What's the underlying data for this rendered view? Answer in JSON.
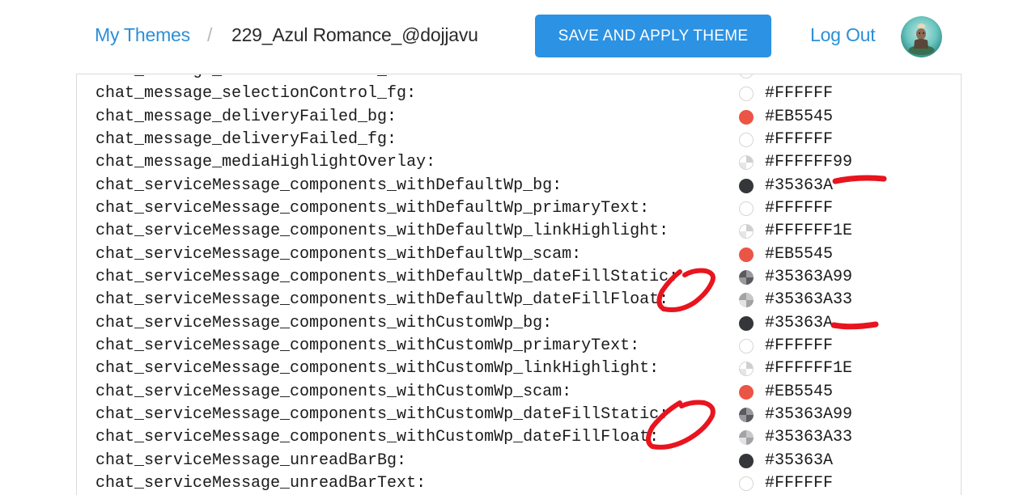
{
  "header": {
    "breadcrumb_link": "My Themes",
    "breadcrumb_separator": "/",
    "breadcrumb_current": "229_Azul Romance_@dojjavu",
    "save_button": "SAVE AND APPLY THEME",
    "logout": "Log Out",
    "accent_color": "#2B92E4"
  },
  "rows": [
    {
      "key": "chat_message_selectionControl_border:",
      "value": "#FFFFFF",
      "swatch": "white"
    },
    {
      "key": "chat_message_selectionControl_fg:",
      "value": "#FFFFFF",
      "swatch": "white"
    },
    {
      "key": "chat_message_deliveryFailed_bg:",
      "value": "#EB5545",
      "swatch": "red"
    },
    {
      "key": "chat_message_deliveryFailed_fg:",
      "value": "#FFFFFF",
      "swatch": "white"
    },
    {
      "key": "chat_message_mediaHighlightOverlay:",
      "value": "#FFFFFF99",
      "swatch": "white-translucent"
    },
    {
      "key": "chat_serviceMessage_components_withDefaultWp_bg:",
      "value": "#35363A",
      "swatch": "dark"
    },
    {
      "key": "chat_serviceMessage_components_withDefaultWp_primaryText:",
      "value": "#FFFFFF",
      "swatch": "white"
    },
    {
      "key": "chat_serviceMessage_components_withDefaultWp_linkHighlight:",
      "value": "#FFFFFF1E",
      "swatch": "white-translucent"
    },
    {
      "key": "chat_serviceMessage_components_withDefaultWp_scam:",
      "value": "#EB5545",
      "swatch": "red"
    },
    {
      "key": "chat_serviceMessage_components_withDefaultWp_dateFillStatic:",
      "value": "#35363A99",
      "swatch": "dark-translucent"
    },
    {
      "key": "chat_serviceMessage_components_withDefaultWp_dateFillFloat:",
      "value": "#35363A33",
      "swatch": "dark-light-translucent"
    },
    {
      "key": "chat_serviceMessage_components_withCustomWp_bg:",
      "value": "#35363A",
      "swatch": "dark"
    },
    {
      "key": "chat_serviceMessage_components_withCustomWp_primaryText:",
      "value": "#FFFFFF",
      "swatch": "white"
    },
    {
      "key": "chat_serviceMessage_components_withCustomWp_linkHighlight:",
      "value": "#FFFFFF1E",
      "swatch": "white-translucent"
    },
    {
      "key": "chat_serviceMessage_components_withCustomWp_scam:",
      "value": "#EB5545",
      "swatch": "red"
    },
    {
      "key": "chat_serviceMessage_components_withCustomWp_dateFillStatic:",
      "value": "#35363A99",
      "swatch": "dark-translucent"
    },
    {
      "key": "chat_serviceMessage_components_withCustomWp_dateFillFloat:",
      "value": "#35363A33",
      "swatch": "dark-light-translucent"
    },
    {
      "key": "chat_serviceMessage_unreadBarBg:",
      "value": "#35363A",
      "swatch": "dark"
    },
    {
      "key": "chat_serviceMessage_unreadBarText:",
      "value": "#FFFFFF",
      "swatch": "white"
    }
  ],
  "annotation_color": "#E8141E"
}
